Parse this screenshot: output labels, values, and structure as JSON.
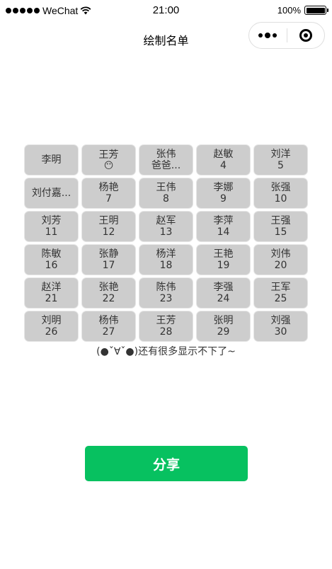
{
  "status_bar": {
    "carrier": "WeChat",
    "time": "21:00",
    "battery_pct": "100%"
  },
  "nav": {
    "title": "绘制名单",
    "more_icon": "more-dots-icon",
    "close_icon": "close-circle-icon"
  },
  "grid": [
    {
      "name": "李明",
      "num": ""
    },
    {
      "name": "王芳",
      "num": "😶"
    },
    {
      "name": "张伟",
      "num": "爸爸..."
    },
    {
      "name": "赵敏",
      "num": "4"
    },
    {
      "name": "刘洋",
      "num": "5"
    },
    {
      "name": "刘付嘉...",
      "num": ""
    },
    {
      "name": "杨艳",
      "num": "7"
    },
    {
      "name": "王伟",
      "num": "8"
    },
    {
      "name": "李娜",
      "num": "9"
    },
    {
      "name": "张强",
      "num": "10"
    },
    {
      "name": "刘芳",
      "num": "11"
    },
    {
      "name": "王明",
      "num": "12"
    },
    {
      "name": "赵军",
      "num": "13"
    },
    {
      "name": "李萍",
      "num": "14"
    },
    {
      "name": "王强",
      "num": "15"
    },
    {
      "name": "陈敏",
      "num": "16"
    },
    {
      "name": "张静",
      "num": "17"
    },
    {
      "name": "杨洋",
      "num": "18"
    },
    {
      "name": "王艳",
      "num": "19"
    },
    {
      "name": "刘伟",
      "num": "20"
    },
    {
      "name": "赵洋",
      "num": "21"
    },
    {
      "name": "张艳",
      "num": "22"
    },
    {
      "name": "陈伟",
      "num": "23"
    },
    {
      "name": "李强",
      "num": "24"
    },
    {
      "name": "王军",
      "num": "25"
    },
    {
      "name": "刘明",
      "num": "26"
    },
    {
      "name": "杨伟",
      "num": "27"
    },
    {
      "name": "王芳",
      "num": "28"
    },
    {
      "name": "张明",
      "num": "29"
    },
    {
      "name": "刘强",
      "num": "30"
    }
  ],
  "note": "(●ˇ∀ˇ●)还有很多显示不下了~",
  "share_label": "分享",
  "colors": {
    "cell_bg": "#cdcdcd",
    "share_green": "#07c160"
  }
}
